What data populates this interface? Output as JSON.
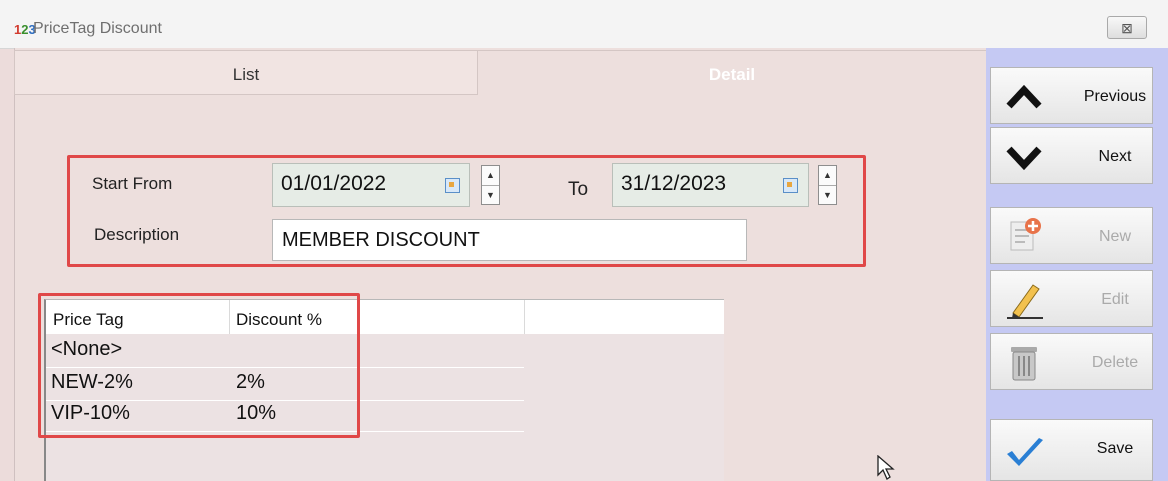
{
  "window": {
    "title": "PriceTag Discount",
    "app_icon": "123-icon",
    "close_symbol": "⊠"
  },
  "tabs": [
    {
      "label": "List",
      "active": false
    },
    {
      "label": "Detail",
      "active": true
    }
  ],
  "form": {
    "start_from_label": "Start From",
    "start_date": "01/01/2022",
    "to_label": "To",
    "end_date": "31/12/2023",
    "description_label": "Description",
    "description_value": "MEMBER DISCOUNT"
  },
  "grid": {
    "columns": [
      "Price Tag",
      "Discount %"
    ],
    "rows": [
      {
        "price_tag": "<None>",
        "discount": ""
      },
      {
        "price_tag": "NEW-2%",
        "discount": "2%"
      },
      {
        "price_tag": "VIP-10%",
        "discount": "10%"
      }
    ]
  },
  "sidebar": {
    "previous": "Previous",
    "next": "Next",
    "new": "New",
    "edit": "Edit",
    "delete": "Delete",
    "save": "Save"
  },
  "colors": {
    "highlight": "#e04848",
    "sidebar_bg": "#c5c9f3",
    "form_bg": "#eddfdd"
  }
}
